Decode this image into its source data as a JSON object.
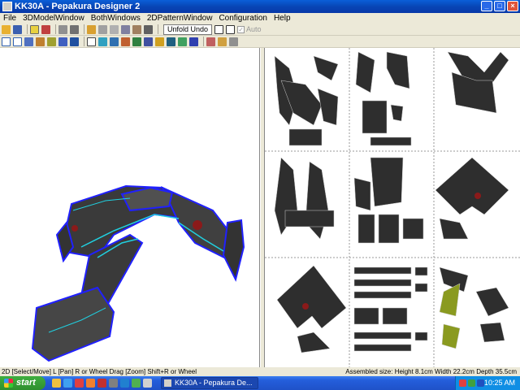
{
  "window": {
    "title": "KK30A - Pepakura Designer 2"
  },
  "menu": [
    "File",
    "3DModelWindow",
    "BothWindows",
    "2DPatternWindow",
    "Configuration",
    "Help"
  ],
  "toolbar": {
    "unfold_undo_label": "Unfold Undo",
    "auto_label": "Auto",
    "auto_checked": true
  },
  "status": {
    "left": "2D [Select/Move] L [Pan] R or Wheel Drag [Zoom] Shift+R or Wheel",
    "right": "Assembled size: Height 8.1cm Width 22.2cm Depth 35.5cm"
  },
  "taskbar": {
    "start_label": "start",
    "task_label": "KK30A - Pepakura De...",
    "clock": "10:25 AM"
  },
  "icons": {
    "toolbar1": [
      "open-folder-icon",
      "save-icon",
      "edit-mode-icon",
      "texture-icon",
      "cube-icon",
      "flat-icon",
      "pencil-icon",
      "join-icon",
      "rotate-icon",
      "move-icon",
      "scale-icon",
      "stack-icon",
      "window-a-icon",
      "window-b-icon"
    ],
    "toolbar2": [
      "fit-icon",
      "fit-all-icon",
      "brush-icon",
      "paint-icon",
      "line-icon",
      "text-icon",
      "image-icon",
      "select-icon",
      "edge-icon",
      "fold-icon",
      "fill-icon",
      "pattern-icon",
      "width-icon",
      "text2-icon",
      "picture-icon",
      "flap-icon",
      "undo-icon",
      "print-icon",
      "settings-icon",
      "page-icon"
    ]
  }
}
